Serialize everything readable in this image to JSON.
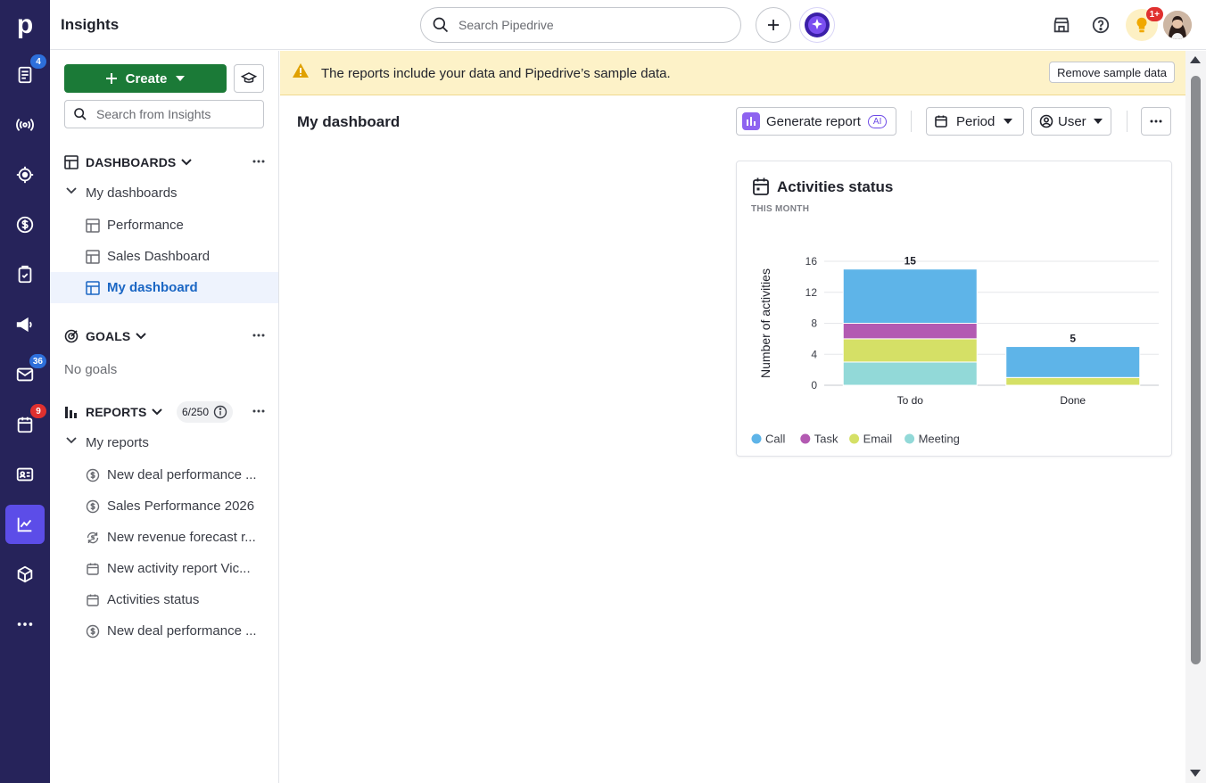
{
  "app": {
    "title": "Insights"
  },
  "topbar": {
    "search_placeholder": "Search Pipedrive",
    "notification_badge": "1+"
  },
  "rail": {
    "badges": {
      "leads": "4",
      "mail": "36",
      "activities": "9"
    }
  },
  "sidebar": {
    "create_label": "Create",
    "search_placeholder": "Search from Insights",
    "dashboards": {
      "title": "DASHBOARDS",
      "folder": "My dashboards",
      "items": [
        {
          "label": "Performance"
        },
        {
          "label": "Sales Dashboard"
        },
        {
          "label": "My dashboard"
        }
      ]
    },
    "goals": {
      "title": "GOALS",
      "empty": "No goals"
    },
    "reports": {
      "title": "REPORTS",
      "count": "6/250",
      "folder": "My reports",
      "items": [
        {
          "label": "New deal performance ...",
          "icon": "dollar-icon"
        },
        {
          "label": "Sales Performance 2026",
          "icon": "dollar-icon"
        },
        {
          "label": "New revenue forecast r...",
          "icon": "forecast-icon"
        },
        {
          "label": "New activity report Vic...",
          "icon": "calendar-icon"
        },
        {
          "label": "Activities status",
          "icon": "calendar-icon"
        },
        {
          "label": "New deal performance ...",
          "icon": "dollar-icon"
        }
      ]
    }
  },
  "banner": {
    "text": "The reports include your data and Pipedrive’s sample data.",
    "button": "Remove sample data"
  },
  "dashboard": {
    "title": "My dashboard",
    "generate_label": "Generate report",
    "ai_tag": "AI",
    "period_label": "Period",
    "user_label": "User"
  },
  "card": {
    "title": "Activities status",
    "subtitle": "THIS MONTH"
  },
  "colors": {
    "Call": "#5eb4e8",
    "Task": "#b35ab2",
    "Email": "#d5e066",
    "Meeting": "#92d9d8"
  },
  "chart_data": {
    "type": "bar",
    "stacked": true,
    "categories": [
      "To do",
      "Done"
    ],
    "series": [
      {
        "name": "Meeting",
        "values": [
          3,
          0
        ]
      },
      {
        "name": "Email",
        "values": [
          3,
          1
        ]
      },
      {
        "name": "Task",
        "values": [
          2,
          0
        ]
      },
      {
        "name": "Call",
        "values": [
          7,
          4
        ]
      }
    ],
    "totals": [
      15,
      5
    ],
    "ylabel": "Number of activities",
    "yticks": [
      0,
      4,
      8,
      12,
      16
    ],
    "ylim": [
      0,
      16
    ],
    "legend": [
      "Call",
      "Task",
      "Email",
      "Meeting"
    ],
    "legend_position": "bottom-left",
    "grid": true
  }
}
